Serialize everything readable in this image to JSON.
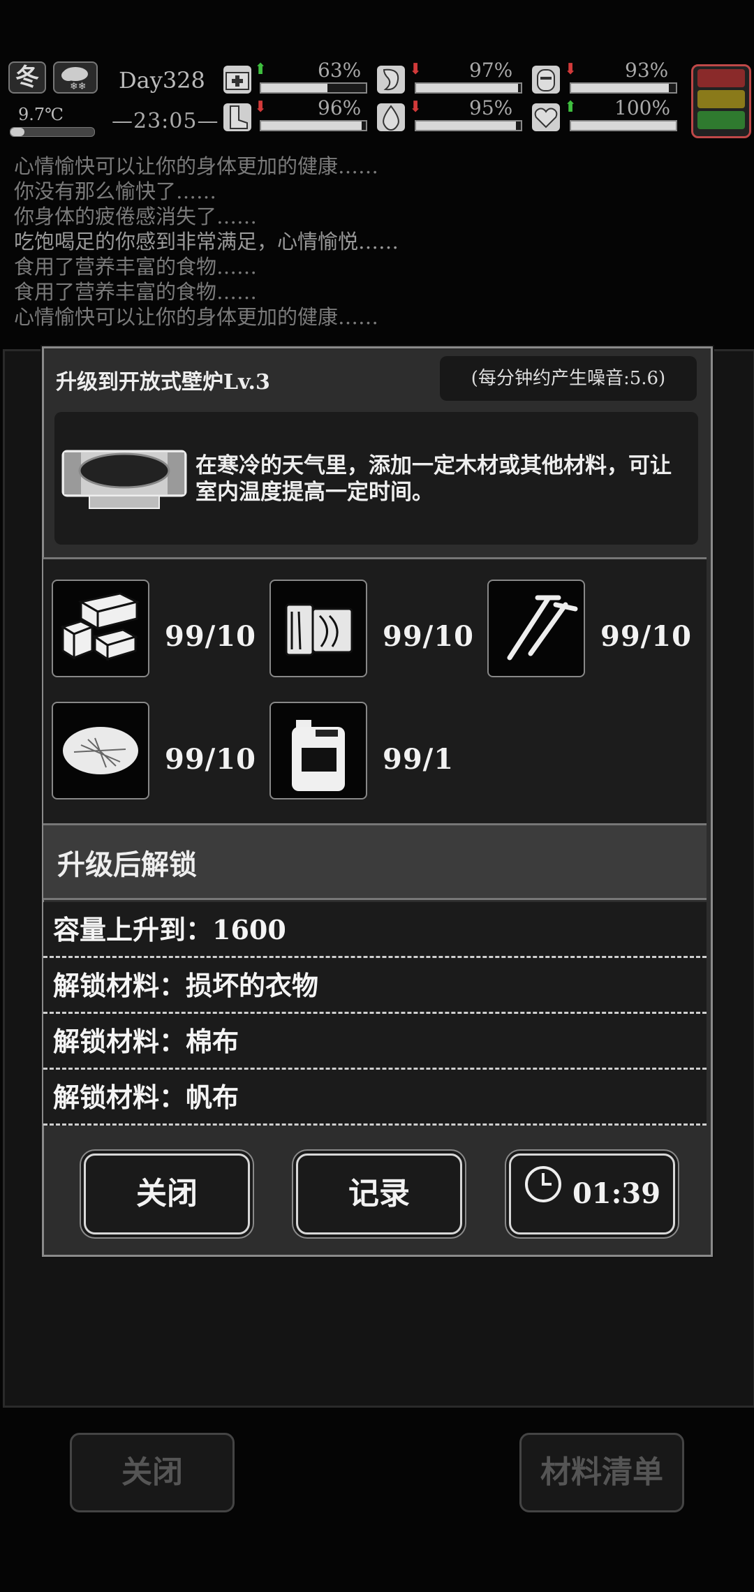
{
  "status": {
    "season": "冬",
    "temperature": "9.7℃",
    "day": "Day328",
    "time": "23:05",
    "stats": [
      {
        "name": "health",
        "trend": "up",
        "value": "63%",
        "fill": 0.63
      },
      {
        "name": "hunger",
        "trend": "down",
        "value": "97%",
        "fill": 0.97
      },
      {
        "name": "mood",
        "trend": "down",
        "value": "93%",
        "fill": 0.93
      },
      {
        "name": "stamina",
        "trend": "down",
        "value": "96%",
        "fill": 0.96
      },
      {
        "name": "thirst",
        "trend": "down",
        "value": "95%",
        "fill": 0.95
      },
      {
        "name": "heart",
        "trend": "up",
        "value": "100%",
        "fill": 1.0
      }
    ]
  },
  "log": [
    "心情愉快可以让你的身体更加的健康……",
    "你没有那么愉快了……",
    "你身体的疲倦感消失了……",
    "吃饱喝足的你感到非常满足，心情愉悦……",
    "食用了营养丰富的食物……",
    "食用了营养丰富的食物……",
    "心情愉快可以让你的身体更加的健康……"
  ],
  "background": {
    "close_label": "关闭",
    "materials_label": "材料清单"
  },
  "dialog": {
    "title": "升级到开放式壁炉Lv.3",
    "noise": "(每分钟约产生噪音:5.6)",
    "description": "在寒冷的天气里，添加一定木材或其他材料，可让室内温度提高一定时间。",
    "materials": [
      {
        "icon": "wood-beams-icon",
        "count": "99/10"
      },
      {
        "icon": "planks-icon",
        "count": "99/10"
      },
      {
        "icon": "nails-icon",
        "count": "99/10"
      },
      {
        "icon": "fiber-icon",
        "count": "99/10"
      },
      {
        "icon": "fuel-can-icon",
        "count": "99/1"
      }
    ],
    "unlock_header": "升级后解锁",
    "unlocks": [
      "容量上升到：1600",
      "解锁材料：损坏的衣物",
      "解锁材料：棉布",
      "解锁材料：帆布"
    ],
    "buttons": {
      "close": "关闭",
      "record": "记录",
      "timer": "01:39"
    }
  }
}
